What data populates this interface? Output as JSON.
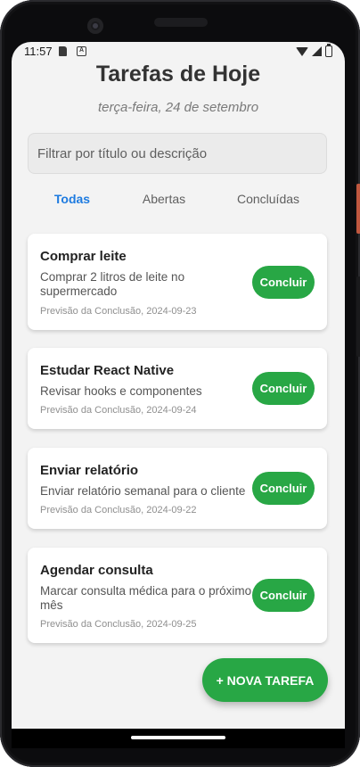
{
  "status_bar": {
    "time": "11:57"
  },
  "header": {
    "title": "Tarefas de Hoje",
    "date": "terça-feira, 24 de setembro"
  },
  "search": {
    "placeholder": "Filtrar por título ou descrição",
    "value": ""
  },
  "tabs": [
    {
      "label": "Todas",
      "active": true
    },
    {
      "label": "Abertas",
      "active": false
    },
    {
      "label": "Concluídas",
      "active": false
    }
  ],
  "tasks": [
    {
      "title": "Comprar leite",
      "description": "Comprar 2 litros de leite no supermercado",
      "due": "Previsão da Conclusão, 2024-09-23",
      "button": "Concluir"
    },
    {
      "title": "Estudar React Native",
      "description": "Revisar hooks e componentes",
      "due": "Previsão da Conclusão, 2024-09-24",
      "button": "Concluir"
    },
    {
      "title": "Enviar relatório",
      "description": "Enviar relatório semanal para o cliente",
      "due": "Previsão da Conclusão, 2024-09-22",
      "button": "Concluir"
    },
    {
      "title": "Agendar consulta",
      "description": "Marcar consulta médica para o próximo mês",
      "due": "Previsão da Conclusão, 2024-09-25",
      "button": "Concluir"
    }
  ],
  "fab": {
    "label": "+ NOVA TAREFA"
  },
  "colors": {
    "accent": "#1e7be0",
    "success": "#28a745",
    "background": "#f3f3f3"
  }
}
